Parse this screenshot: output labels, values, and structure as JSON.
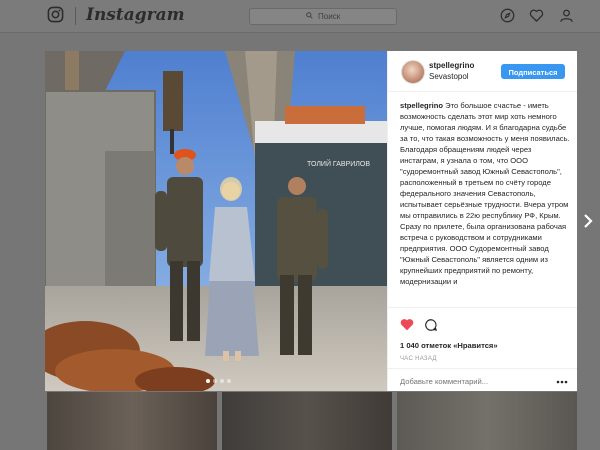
{
  "topbar": {
    "brand": "Instagram",
    "search_placeholder": "Поиск",
    "icons": [
      "instagram-glyph-icon",
      "search-icon",
      "compass-icon",
      "heart-icon",
      "profile-icon"
    ]
  },
  "post": {
    "username": "stpellegrino",
    "location": "Sevastopol",
    "follow_label": "Подписаться",
    "caption_text": "Это большое счастье - иметь возможность сделать этот мир хоть немного лучше, помогая людям. И я благодарна судьбе за то, что такая возможность у меня появилась. Благодаря обращениям людей через инстаграм, я узнала о том, что ООО \"судоремонтный завод Южный Севастополь\", расположенный в третьем по счёту городе федерального значения Севастополь, испытывает серьёзные трудности. Вчера утром мы отправились в 22ю республику РФ, Крым. Сразу по прилете, была организована рабочая встреча с руководством и сотрудниками предприятия. ООО Судоремонтный завод \"Южный Севастополь\" является одним из крупнейших предприятий по ремонту, модернизации и",
    "likes": "1 040 отметок «Нравится»",
    "time_ago": "ЧАС НАЗАД",
    "comment_placeholder": "Добавьте комментарий...",
    "photo_ship_name": "ТОЛИЙ ГАВРИЛОВ"
  },
  "colors": {
    "accent": "#3897f0",
    "like_red": "#ed4956",
    "overlay": "#767676"
  }
}
